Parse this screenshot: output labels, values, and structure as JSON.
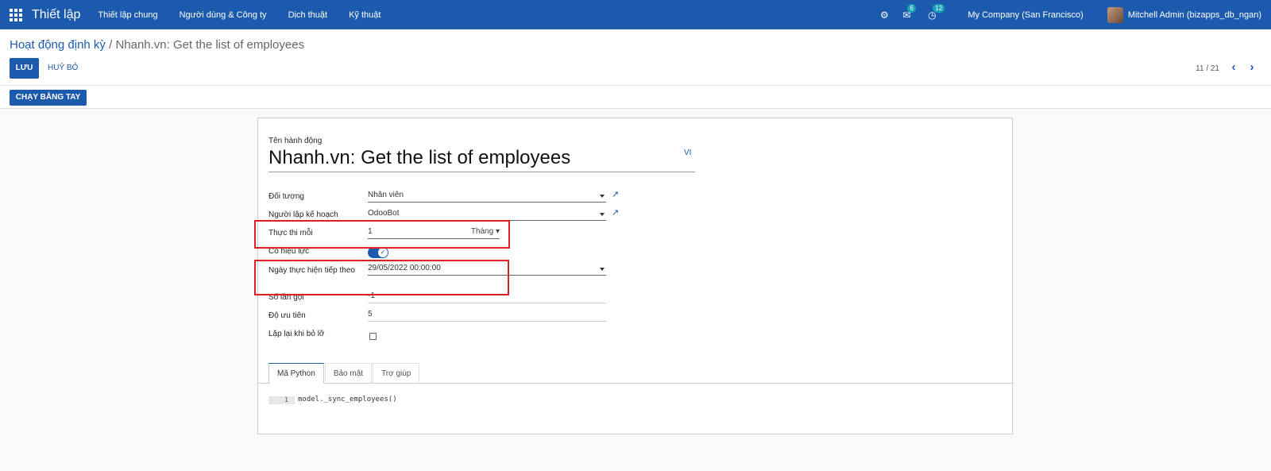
{
  "navbar": {
    "app_title": "Thiết lập",
    "menu": [
      "Thiết lập chung",
      "Người dùng & Công ty",
      "Dịch thuật",
      "Kỹ thuật"
    ],
    "messages_count": "6",
    "activities_count": "12",
    "company": "My Company (San Francisco)",
    "user": "Mitchell Admin (bizapps_db_ngan)"
  },
  "breadcrumb": {
    "parent": "Hoạt động định kỳ",
    "separator": " / ",
    "current": "Nhanh.vn: Get the list of employees"
  },
  "buttons": {
    "save": "LƯU",
    "discard": "HUỶ BỎ",
    "run_manually": "CHẠY BẰNG TAY"
  },
  "pager": {
    "value": "11 / 21",
    "prev": "‹",
    "next": "›"
  },
  "form": {
    "name_label": "Tên hành động",
    "name_value": "Nhanh.vn: Get the list of employees",
    "lang": "VI",
    "fields": {
      "model_label": "Đối tượng",
      "model_value": "Nhân viên",
      "user_label": "Người lập kế hoạch",
      "user_value": "OdooBot",
      "interval_label": "Thực thi mỗi",
      "interval_number": "1",
      "interval_type": "Tháng",
      "active_label": "Có hiệu lực",
      "active_value": true,
      "nextcall_label": "Ngày thực hiện tiếp theo",
      "nextcall_value": "29/05/2022 00:00:00",
      "numbercall_label": "Số lần gọi",
      "numbercall_value": "-1",
      "priority_label": "Độ ưu tiên",
      "priority_value": "5",
      "doall_label": "Lặp lại khi bỏ lỡ",
      "doall_value": false
    },
    "tabs": [
      "Mã Python",
      "Bảo mật",
      "Trợ giúp"
    ],
    "code": {
      "line_number": "1",
      "text": "model._sync_employees()"
    }
  },
  "colors": {
    "brand": "#1c5aad",
    "highlight": "#e02020"
  }
}
